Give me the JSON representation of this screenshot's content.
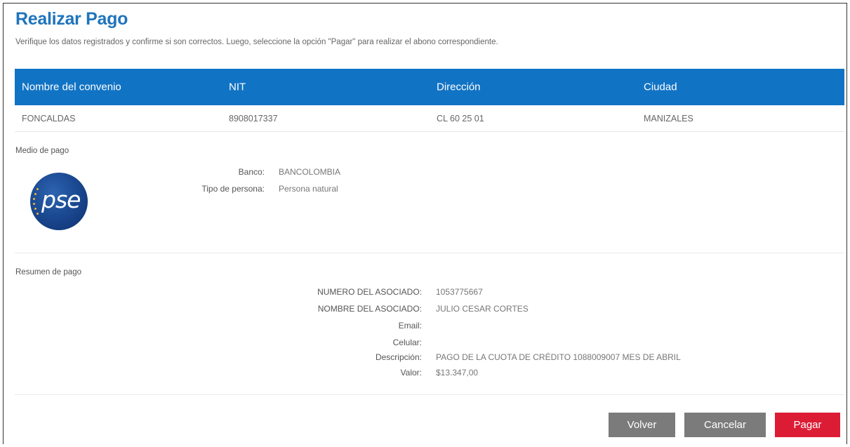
{
  "page": {
    "title": "Realizar Pago",
    "subtitle": "Verifique los datos registrados y confirme si son correctos. Luego, seleccione la opción \"Pagar\" para realizar el abono correspondiente."
  },
  "convenio_table": {
    "headers": [
      "Nombre del convenio",
      "NIT",
      "Dirección",
      "Ciudad"
    ],
    "row": [
      "FONCALDAS",
      "8908017337",
      "CL 60 25 01",
      "MANIZALES"
    ]
  },
  "medio_pago": {
    "label": "Medio de pago",
    "logo_text": "pse",
    "banco_label": "Banco:",
    "banco_value": "BANCOLOMBIA",
    "tipo_label": "Tipo de persona:",
    "tipo_value": "Persona natural"
  },
  "resumen": {
    "label": "Resumen de pago",
    "rows": [
      {
        "label": "NUMERO DEL ASOCIADO:",
        "value": "1053775667"
      },
      {
        "label": "NOMBRE DEL ASOCIADO:",
        "value": "JULIO CESAR CORTES"
      },
      {
        "label": "Email:",
        "value": ""
      },
      {
        "label": "Celular:",
        "value": ""
      },
      {
        "label": "Descripción:",
        "value": "PAGO DE LA CUOTA DE CRÉDITO 1088009007 MES DE ABRIL"
      },
      {
        "label": "Valor:",
        "value": "$13.347,00"
      }
    ]
  },
  "actions": {
    "volver": "Volver",
    "cancelar": "Cancelar",
    "pagar": "Pagar"
  },
  "colors": {
    "title": "#1f74bb",
    "table_header": "#1173c4",
    "secondary_button": "#7b7b7b",
    "primary_button": "#dc1c35"
  }
}
